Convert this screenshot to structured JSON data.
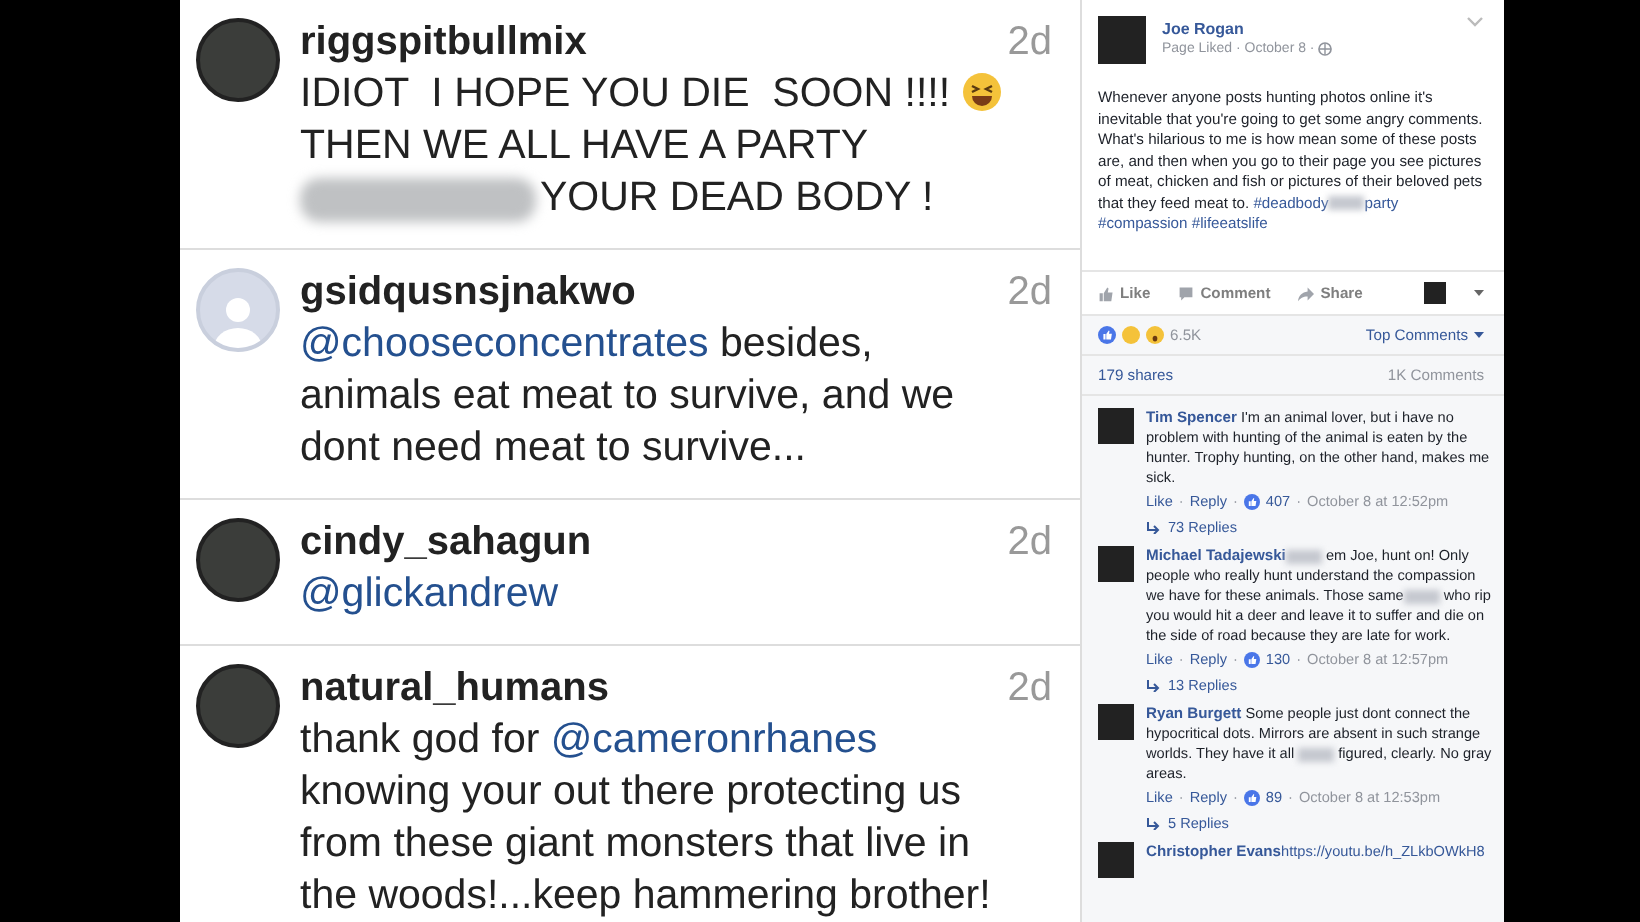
{
  "instagram": {
    "comments": [
      {
        "username": "riggspitbullmix",
        "time": "2d",
        "has_photo": true,
        "lines": [
          [
            {
              "kind": "text",
              "text": "IDIOT  I HOPE YOU DIE  SOON !!!! "
            },
            {
              "kind": "emoji"
            }
          ],
          [
            {
              "kind": "text",
              "text": "THEN WE ALL HAVE A PARTY"
            }
          ],
          [
            {
              "kind": "blur"
            },
            {
              "kind": "text",
              "text": "YOUR DEAD BODY !"
            }
          ]
        ]
      },
      {
        "username": "gsidqusnsjnakwo",
        "time": "2d",
        "has_photo": false,
        "lines": [
          [
            {
              "kind": "mention",
              "text": "@chooseconcentrates"
            },
            {
              "kind": "text",
              "text": " besides,"
            }
          ],
          [
            {
              "kind": "text",
              "text": "animals eat meat to survive, and we"
            }
          ],
          [
            {
              "kind": "text",
              "text": "dont need meat to survive..."
            }
          ]
        ]
      },
      {
        "username": "cindy_sahagun",
        "time": "2d",
        "has_photo": true,
        "lines": [
          [
            {
              "kind": "mention",
              "text": "@glickandrew"
            }
          ]
        ]
      },
      {
        "username": "natural_humans",
        "time": "2d",
        "has_photo": true,
        "lines": [
          [
            {
              "kind": "text",
              "text": "thank god for "
            },
            {
              "kind": "mention",
              "text": "@cameronrhanes"
            }
          ],
          [
            {
              "kind": "text",
              "text": "knowing your out there protecting us"
            }
          ],
          [
            {
              "kind": "text",
              "text": "from these giant monsters that live in"
            }
          ],
          [
            {
              "kind": "text",
              "text": "the woods!...keep hammering brother!"
            }
          ]
        ]
      }
    ]
  },
  "facebook": {
    "page": "Joe Rogan",
    "meta": "Page Liked · October 8 ·",
    "post": [
      {
        "kind": "text",
        "text": "Whenever anyone posts hunting photos online it's inevitable that you're going to get some angry comments. What's hilarious to me is how mean some of these posts are, and then when you go to their page you see pictures of meat, chicken and fish or pictures of their beloved pets that they feed meat to. "
      },
      {
        "kind": "link",
        "text": "#deadbody"
      },
      {
        "kind": "blur"
      },
      {
        "kind": "link",
        "text": "party #compassion #lifeeatslife"
      }
    ],
    "actions": [
      "Like",
      "Comment",
      "Share"
    ],
    "reactions": "6.5K",
    "sort": "Top Comments",
    "shares": "179 shares",
    "comments_count": "1K Comments",
    "comments": [
      {
        "author": "Tim Spencer",
        "text": [
          {
            "kind": "text",
            "text": " I'm an animal lover, but i have no problem with hunting of the animal is eaten by the hunter. Trophy hunting, on the other hand, makes me sick."
          }
        ],
        "footer": [
          {
            "kind": "like",
            "text": "Like"
          },
          {
            "kind": "sep",
            "text": "·"
          },
          {
            "kind": "reply",
            "text": "Reply"
          },
          {
            "kind": "sep",
            "text": "·"
          },
          {
            "kind": "likes",
            "text": "407"
          },
          {
            "kind": "sep",
            "text": "·"
          },
          {
            "kind": "date",
            "text": "October 8 at 12:52pm"
          }
        ],
        "replies": "73 Replies"
      },
      {
        "author": "Michael Tadajewski",
        "text": [
          {
            "kind": "blur"
          },
          {
            "kind": "text",
            "text": " em Joe, hunt on! Only people who really hunt understand the compassion we have for these animals. Those same"
          },
          {
            "kind": "blur"
          },
          {
            "kind": "text",
            "text": " who rip you would hit a deer and leave it to suffer and die on the side of road because they are late for work."
          }
        ],
        "footer": [
          {
            "kind": "like",
            "text": "Like"
          },
          {
            "kind": "sep",
            "text": "·"
          },
          {
            "kind": "reply",
            "text": "Reply"
          },
          {
            "kind": "sep",
            "text": "·"
          },
          {
            "kind": "likes",
            "text": "130"
          },
          {
            "kind": "sep",
            "text": "·"
          },
          {
            "kind": "date",
            "text": "October 8 at 12:57pm"
          }
        ],
        "replies": "13 Replies"
      },
      {
        "author": "Ryan Burgett",
        "text": [
          {
            "kind": "text",
            "text": " Some people just dont connect the hypocritical dots. Mirrors are absent in such strange worlds. They have it all "
          },
          {
            "kind": "blur"
          },
          {
            "kind": "text",
            "text": " figured, clearly. No gray areas."
          }
        ],
        "footer": [
          {
            "kind": "like",
            "text": "Like"
          },
          {
            "kind": "sep",
            "text": "·"
          },
          {
            "kind": "reply",
            "text": "Reply"
          },
          {
            "kind": "sep",
            "text": "·"
          },
          {
            "kind": "likes",
            "text": "89"
          },
          {
            "kind": "sep",
            "text": "·"
          },
          {
            "kind": "date",
            "text": "October 8 at 12:53pm"
          }
        ],
        "replies": "5 Replies"
      },
      {
        "author": "Christopher Evans",
        "text": [
          {
            "kind": "link",
            "text": "https://youtu.be/h_ZLkbOWkH8"
          }
        ]
      }
    ]
  }
}
